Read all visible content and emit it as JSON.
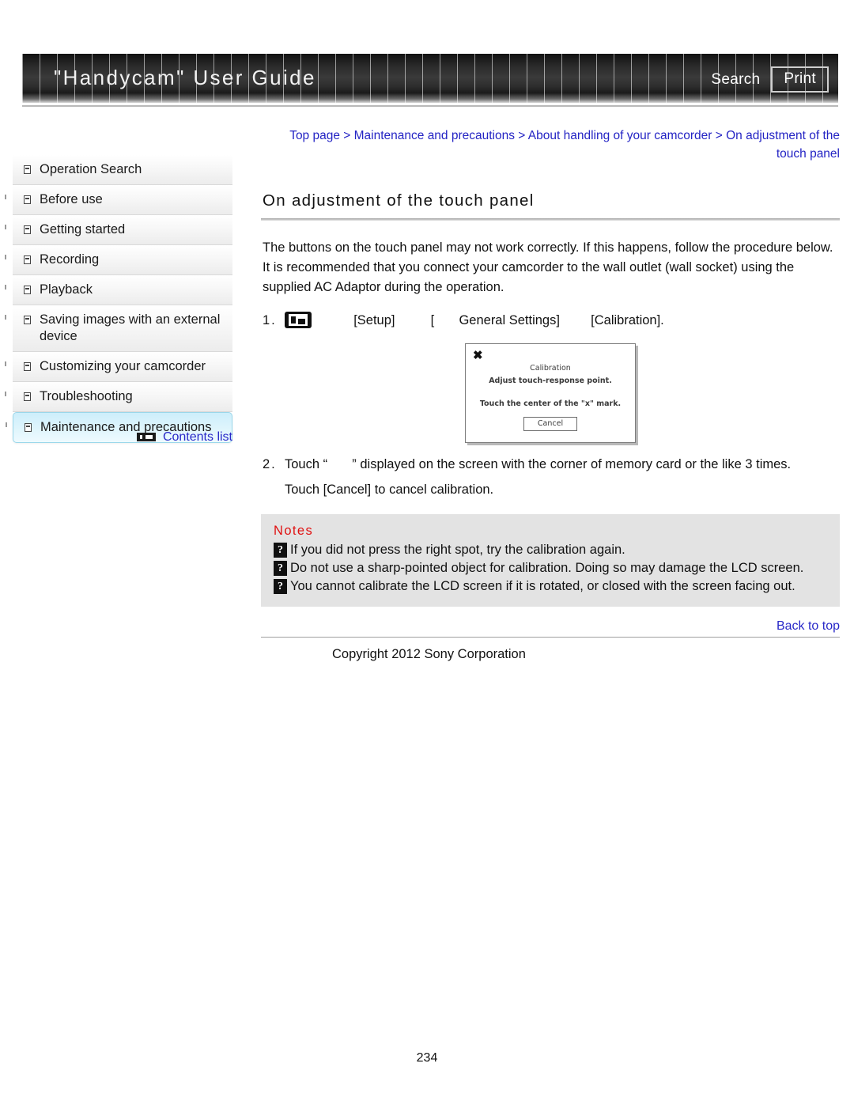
{
  "header": {
    "site_title": "\"Handycam\" User Guide",
    "search_label": "Search",
    "print_label": "Print"
  },
  "sidebar": {
    "items": [
      {
        "label": "Operation Search",
        "selected": false
      },
      {
        "label": "Before use",
        "selected": false
      },
      {
        "label": "Getting started",
        "selected": false
      },
      {
        "label": "Recording",
        "selected": false
      },
      {
        "label": "Playback",
        "selected": false
      },
      {
        "label": "Saving images with an external device",
        "selected": false
      },
      {
        "label": "Customizing your camcorder",
        "selected": false
      },
      {
        "label": "Troubleshooting",
        "selected": false
      },
      {
        "label": "Maintenance and precautions",
        "selected": true
      }
    ],
    "contents_list_label": "Contents list"
  },
  "main": {
    "breadcrumb": "Top page > Maintenance and precautions > About handling of your camcorder > On adjustment of the touch panel",
    "page_title": "On adjustment of the touch panel",
    "intro": "The buttons on the touch panel may not work correctly. If this happens, follow the procedure below. It is recommended that you connect your camcorder to the wall outlet (wall socket) using the supplied AC Adaptor during the operation.",
    "steps": [
      {
        "number": "1.",
        "part_setup": "[Setup]",
        "part_bracket": "[",
        "part_general": "General Settings]",
        "part_calibration": "[Calibration]."
      },
      {
        "number": "2.",
        "line1_a": "Touch “",
        "line1_b": "” displayed on the screen with the corner of memory card or the like 3 times.",
        "line2": "Touch [Cancel] to cancel calibration."
      }
    ],
    "calibration_image": {
      "x_mark": "✖",
      "title": "Calibration",
      "subtitle": "Adjust touch-response point.",
      "instruction": "Touch the center of the \"x\" mark.",
      "cancel_label": "Cancel"
    },
    "notes": {
      "title": "Notes",
      "placeholder_glyph": "?",
      "items": [
        "If you did not press the right spot, try the calibration again.",
        "Do not use a sharp-pointed object for calibration. Doing so may damage the LCD screen.",
        "You cannot calibrate the LCD screen if it is rotated, or closed with the screen facing out."
      ]
    },
    "back_to_top": "Back to top",
    "copyright": "Copyright 2012 Sony Corporation"
  },
  "page_number": "234",
  "colors": {
    "link": "#2828c8",
    "notes_title": "#e01010",
    "selected_bg": "#cdeefb",
    "notes_bg": "#e3e3e3"
  }
}
